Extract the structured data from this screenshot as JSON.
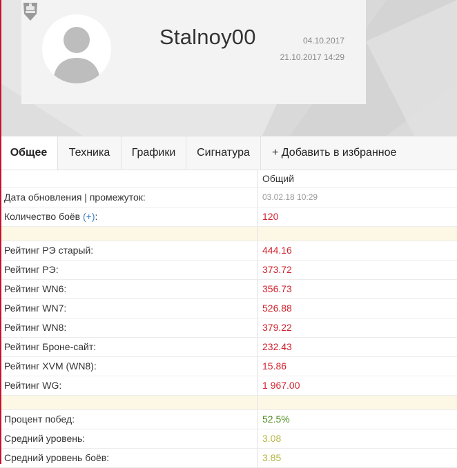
{
  "profile": {
    "avatar_icon": "default-user-avatar-icon",
    "game_icon": "tank-icon",
    "username": "Stalnoy00",
    "registration_date": "04.10.2017",
    "last_battle": "21.10.2017 14:29"
  },
  "tabs": [
    {
      "label": "Общее",
      "active": true
    },
    {
      "label": "Техника",
      "active": false
    },
    {
      "label": "Графики",
      "active": false
    },
    {
      "label": "Сигнатура",
      "active": false
    },
    {
      "label": "+ Добавить в избранное",
      "active": false
    }
  ],
  "table": {
    "column_header": "Общий",
    "updated": {
      "label": "Дата обновления | промежуток:",
      "value": "03.02.18 10:29"
    },
    "battles": {
      "label": "Количество боёв",
      "plus": "(+)",
      "colon": ":",
      "value": "120"
    },
    "ratings": [
      {
        "label": "Рейтинг РЭ старый:",
        "value": "444.16"
      },
      {
        "label": "Рейтинг РЭ:",
        "value": "373.72"
      },
      {
        "label": "Рейтинг WN6:",
        "value": "356.73"
      },
      {
        "label": "Рейтинг WN7:",
        "value": "526.88"
      },
      {
        "label": "Рейтинг WN8:",
        "value": "379.22"
      },
      {
        "label": "Рейтинг Броне-сайт:",
        "value": "232.43"
      },
      {
        "label": "Рейтинг XVM (WN8):",
        "value": "15.86"
      },
      {
        "label": "Рейтинг WG:",
        "value": "1 967.00"
      }
    ],
    "stats": [
      {
        "label": "Процент побед:",
        "value": "52.5%"
      },
      {
        "label": "Средний уровень:",
        "value": "3.08"
      },
      {
        "label": "Средний уровень боёв:",
        "value": "3.85"
      }
    ]
  },
  "colors": {
    "accent_red": "#d2222d",
    "win_green": "#4b8b1f",
    "level_olive": "#b5b545",
    "link_blue": "#3b7fc4",
    "separator_cream": "#fdf8e6"
  }
}
